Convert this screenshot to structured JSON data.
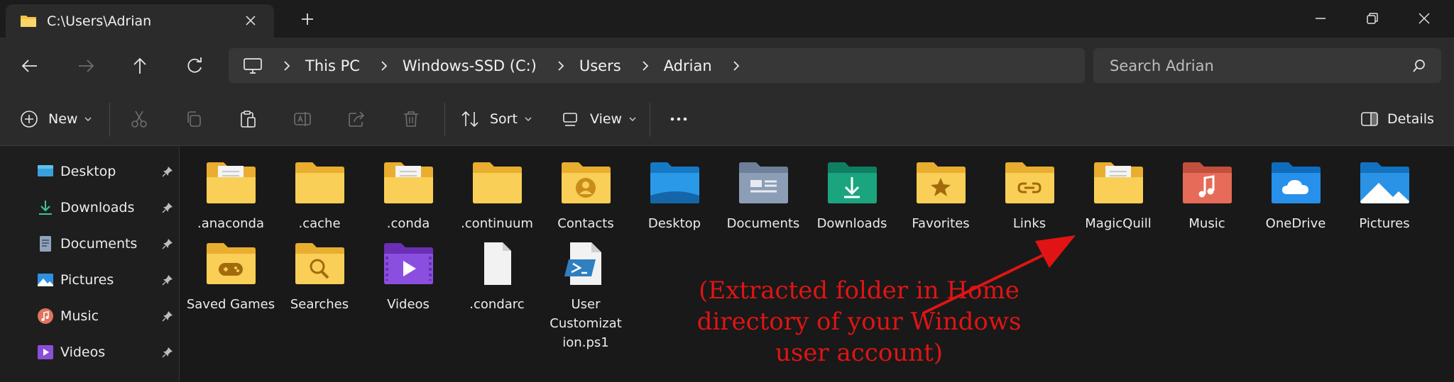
{
  "window": {
    "tab_title": "C:\\Users\\Adrian"
  },
  "address": {
    "crumbs": [
      "This PC",
      "Windows-SSD (C:)",
      "Users",
      "Adrian"
    ]
  },
  "search": {
    "placeholder": "Search Adrian"
  },
  "toolbar": {
    "new_label": "New",
    "sort_label": "Sort",
    "view_label": "View",
    "details_label": "Details"
  },
  "sidebar": {
    "items": [
      {
        "label": "Desktop",
        "icon": "desktop-icon"
      },
      {
        "label": "Downloads",
        "icon": "downloads-icon"
      },
      {
        "label": "Documents",
        "icon": "documents-icon"
      },
      {
        "label": "Pictures",
        "icon": "pictures-icon"
      },
      {
        "label": "Music",
        "icon": "music-icon"
      },
      {
        "label": "Videos",
        "icon": "videos-icon"
      }
    ]
  },
  "files": {
    "row1": [
      {
        "label": ".anaconda",
        "icon": "folder-doc-icon"
      },
      {
        "label": ".cache",
        "icon": "folder-icon"
      },
      {
        "label": ".conda",
        "icon": "folder-doc-icon"
      },
      {
        "label": ".continuum",
        "icon": "folder-icon"
      },
      {
        "label": "Contacts",
        "icon": "contacts-folder-icon"
      },
      {
        "label": "Desktop",
        "icon": "desktop-folder-icon"
      },
      {
        "label": "Documents",
        "icon": "documents-folder-icon"
      },
      {
        "label": "Downloads",
        "icon": "downloads-folder-icon"
      },
      {
        "label": "Favorites",
        "icon": "favorites-folder-icon"
      },
      {
        "label": "Links",
        "icon": "links-folder-icon"
      },
      {
        "label": "MagicQuill",
        "icon": "folder-doc-icon"
      },
      {
        "label": "Music",
        "icon": "music-folder-icon"
      },
      {
        "label": "OneDrive",
        "icon": "onedrive-folder-icon"
      },
      {
        "label": "Pictures",
        "icon": "pictures-folder-icon"
      }
    ],
    "row2": [
      {
        "label": "Saved Games",
        "icon": "saved-games-folder-icon"
      },
      {
        "label": "Searches",
        "icon": "searches-folder-icon"
      },
      {
        "label": "Videos",
        "icon": "videos-folder-icon"
      },
      {
        "label": ".condarc",
        "icon": "file-icon"
      },
      {
        "label": "User Customizat ion.ps1",
        "icon": "powershell-file-icon"
      }
    ]
  },
  "annotation": {
    "text": "(Extracted folder in Home directory of your Windows user account)"
  },
  "colors": {
    "folder": "#f6c445",
    "annotation": "#e01414",
    "background": "#191919"
  }
}
